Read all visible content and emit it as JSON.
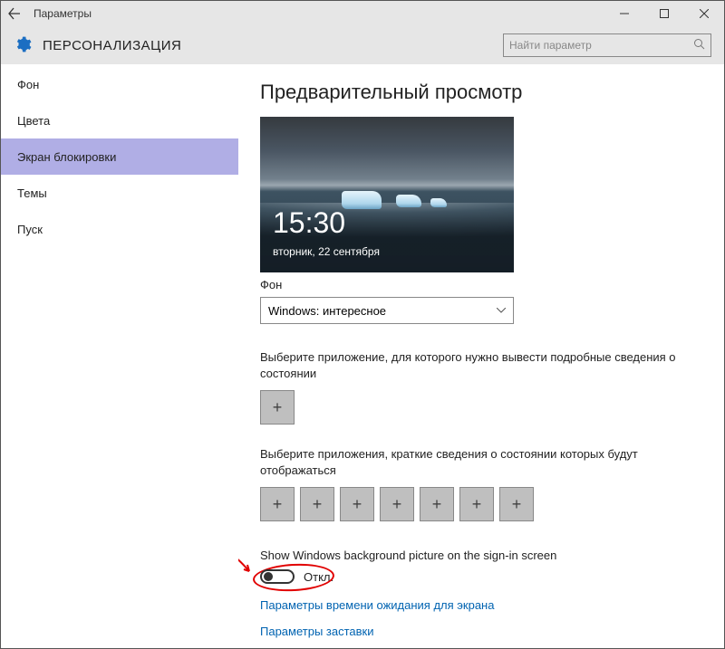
{
  "window": {
    "title": "Параметры"
  },
  "header": {
    "section": "ПЕРСОНАЛИЗАЦИЯ"
  },
  "search": {
    "placeholder": "Найти параметр"
  },
  "sidebar": {
    "items": [
      {
        "label": "Фон"
      },
      {
        "label": "Цвета"
      },
      {
        "label": "Экран блокировки"
      },
      {
        "label": "Темы"
      },
      {
        "label": "Пуск"
      }
    ]
  },
  "main": {
    "preview_title": "Предварительный просмотр",
    "preview": {
      "time": "15:30",
      "date": "вторник, 22 сентября"
    },
    "bg_label": "Фон",
    "bg_value": "Windows: интересное",
    "detailed_desc": "Выберите приложение, для которого нужно вывести подробные сведения о состоянии",
    "quick_desc": "Выберите приложения, краткие сведения о состоянии которых будут отображаться",
    "toggle_label": "Show Windows background picture on the sign-in screen",
    "toggle_state": "Откл.",
    "link1": "Параметры времени ожидания для экрана",
    "link2": "Параметры заставки",
    "plus": "+"
  }
}
